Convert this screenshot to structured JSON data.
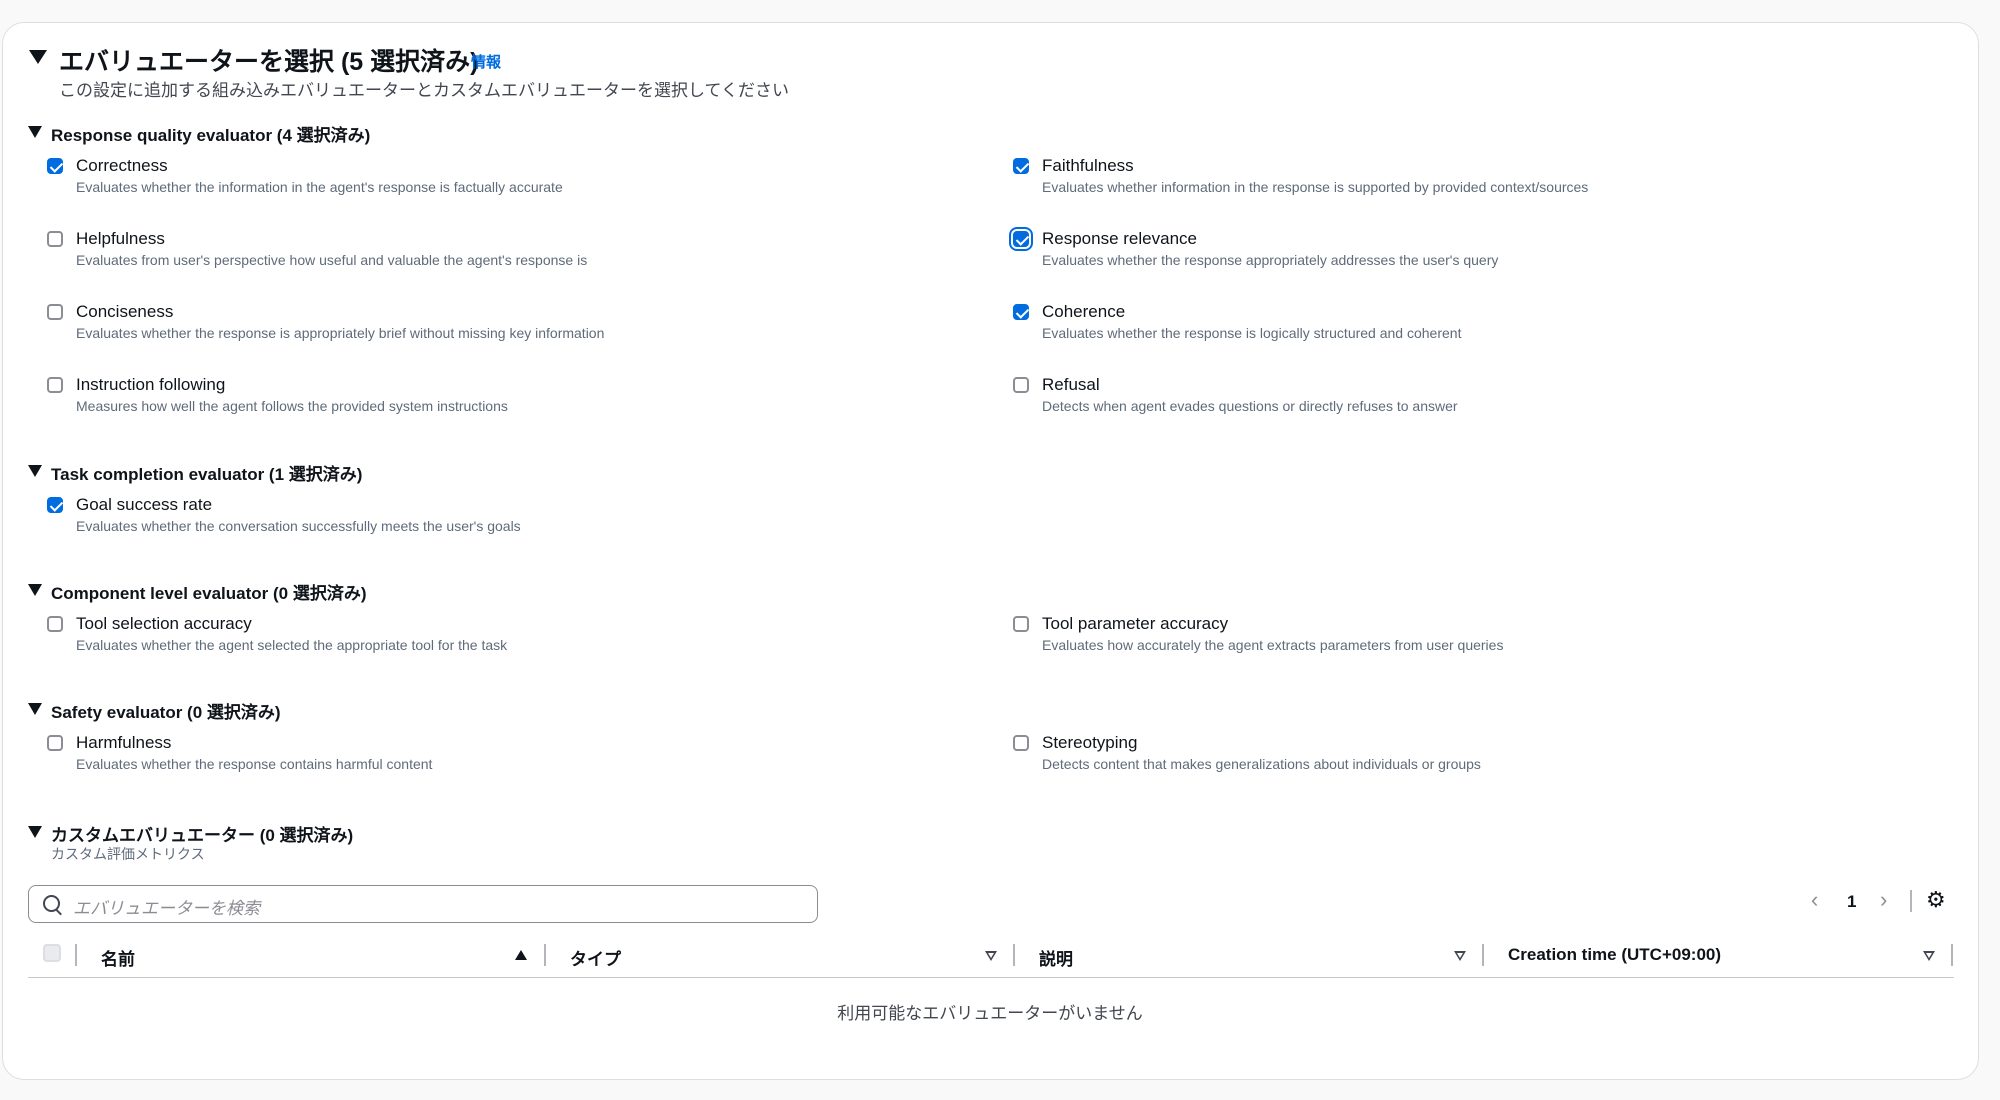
{
  "header": {
    "title": "エバリュエーターを選択 (5 選択済み)",
    "info_link": "情報",
    "description": "この設定に追加する組み込みエバリュエーターとカスタムエバリュエーターを選択してください"
  },
  "sections": {
    "response_quality": {
      "title": "Response quality evaluator (4 選択済み)",
      "items": [
        {
          "label": "Correctness",
          "desc": "Evaluates whether the information in the agent's response is factually accurate",
          "checked": true
        },
        {
          "label": "Faithfulness",
          "desc": "Evaluates whether information in the response is supported by provided context/sources",
          "checked": true
        },
        {
          "label": "Helpfulness",
          "desc": "Evaluates from user's perspective how useful and valuable the agent's response is",
          "checked": false
        },
        {
          "label": "Response relevance",
          "desc": "Evaluates whether the response appropriately addresses the user's query",
          "checked": true
        },
        {
          "label": "Conciseness",
          "desc": "Evaluates whether the response is appropriately brief without missing key information",
          "checked": false
        },
        {
          "label": "Coherence",
          "desc": "Evaluates whether the response is logically structured and coherent",
          "checked": true
        },
        {
          "label": "Instruction following",
          "desc": "Measures how well the agent follows the provided system instructions",
          "checked": false
        },
        {
          "label": "Refusal",
          "desc": "Detects when agent evades questions or directly refuses to answer",
          "checked": false
        }
      ]
    },
    "task_completion": {
      "title": "Task completion evaluator (1 選択済み)",
      "items": [
        {
          "label": "Goal success rate",
          "desc": "Evaluates whether the conversation successfully meets the user's goals",
          "checked": true
        }
      ]
    },
    "component_level": {
      "title": "Component level evaluator (0 選択済み)",
      "items": [
        {
          "label": "Tool selection accuracy",
          "desc": "Evaluates whether the agent selected the appropriate tool for the task",
          "checked": false
        },
        {
          "label": "Tool parameter accuracy",
          "desc": "Evaluates how accurately the agent extracts parameters from user queries",
          "checked": false
        }
      ]
    },
    "safety": {
      "title": "Safety evaluator (0 選択済み)",
      "items": [
        {
          "label": "Harmfulness",
          "desc": "Evaluates whether the response contains harmful content",
          "checked": false
        },
        {
          "label": "Stereotyping",
          "desc": "Detects content that makes generalizations about individuals or groups",
          "checked": false
        }
      ]
    },
    "custom": {
      "title": "カスタムエバリュエーター (0 選択済み)",
      "subtitle": "カスタム評価メトリクス"
    }
  },
  "search": {
    "placeholder": "エバリュエーターを検索"
  },
  "pagination": {
    "page": "1"
  },
  "table": {
    "columns": [
      "名前",
      "タイプ",
      "説明",
      "Creation time (UTC+09:00)"
    ],
    "empty": "利用可能なエバリュエーターがいません"
  },
  "icons": {
    "search": "search-icon",
    "settings": "gear-icon",
    "prev": "chevron-left-icon",
    "next": "chevron-right-icon"
  },
  "colors": {
    "accent": "#006ce0",
    "text": "#0f141a",
    "muted": "#5f6b7a"
  }
}
